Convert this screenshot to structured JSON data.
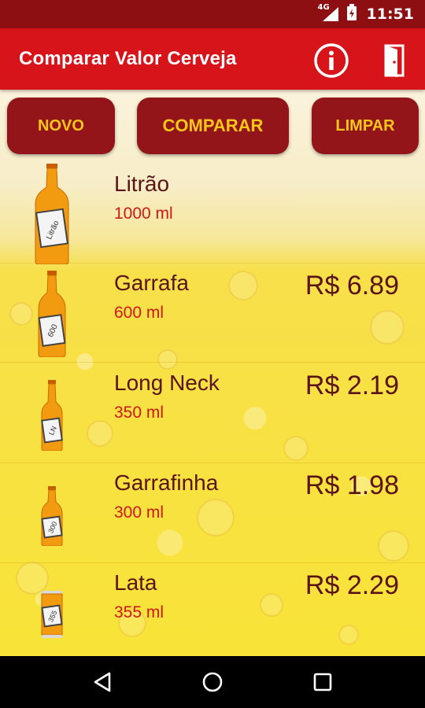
{
  "status_bar": {
    "network": "4G",
    "time": "11:51"
  },
  "app_bar": {
    "title": "Comparar Valor Cerveja",
    "info_icon": "info-icon",
    "exit_icon": "exit-door-icon"
  },
  "buttons": {
    "novo": "NOVO",
    "comparar": "COMPARAR",
    "limpar": "LIMPAR"
  },
  "items": [
    {
      "name": "Litrão",
      "volume": "1000 ml",
      "price": "",
      "bottle_label": "Litrão"
    },
    {
      "name": "Garrafa",
      "volume": "600 ml",
      "price": "R$ 6.89",
      "bottle_label": "600"
    },
    {
      "name": "Long Neck",
      "volume": "350 ml",
      "price": "R$ 2.19",
      "bottle_label": "LN"
    },
    {
      "name": "Garrafinha",
      "volume": "300 ml",
      "price": "R$ 1.98",
      "bottle_label": "300"
    },
    {
      "name": "Lata",
      "volume": "355 ml",
      "price": "R$ 2.29",
      "bottle_label": "355"
    }
  ],
  "colors": {
    "app_bar": "#d8141b",
    "status_bar": "#8e0f12",
    "button_bg": "#941519",
    "button_text": "#f7c61a",
    "name_text": "#5a1418",
    "volume_text": "#d01818"
  }
}
